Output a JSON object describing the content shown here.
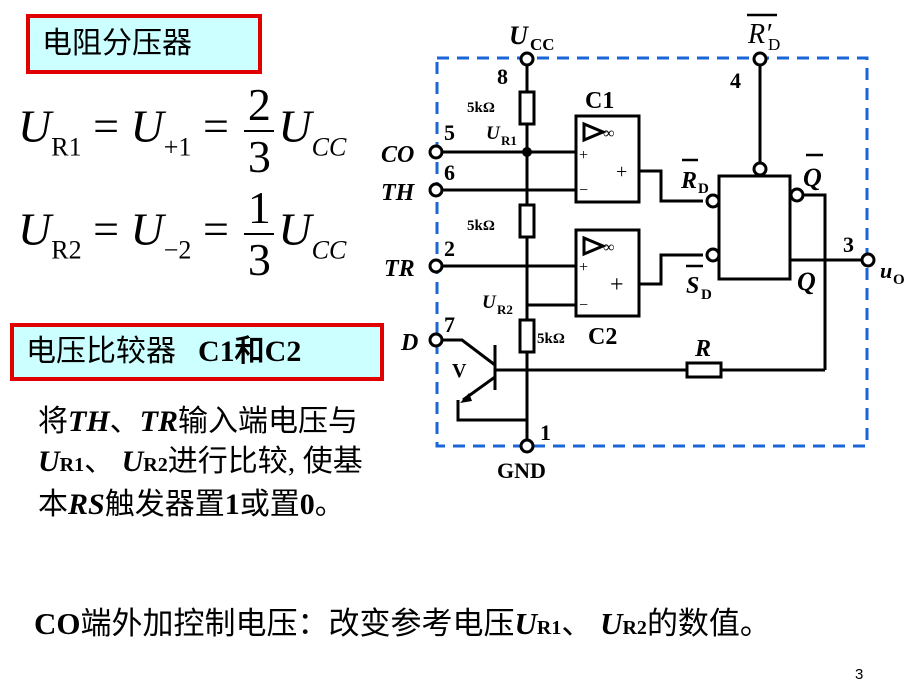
{
  "slide": {
    "page_number": "3",
    "section1": {
      "title": "电阻分压器"
    },
    "equations": {
      "eq1": {
        "lhs_main": "U",
        "lhs_sub": "R1",
        "mid_main": "U",
        "mid_sub": "+1",
        "num": "2",
        "den": "3",
        "rhs_main": "U",
        "rhs_sub": "CC"
      },
      "eq2": {
        "lhs_main": "U",
        "lhs_sub": "R2",
        "mid_main": "U",
        "mid_sub": "−2",
        "num": "1",
        "den": "3",
        "rhs_main": "U",
        "rhs_sub": "CC"
      }
    },
    "section2": {
      "title": "电压比较器",
      "title_latin": "C1和C2"
    },
    "paragraph": {
      "p1": "将",
      "th": "TH",
      "p2": "、",
      "tr": "TR",
      "p3": "输入端电压与",
      "u1": "U",
      "u1_sub": "R1",
      "p4": "、 ",
      "u2": "U",
      "u2_sub": "R2",
      "p5": "进行比较, 使基本",
      "rs": "RS",
      "p6": "触发器置",
      "one": "1",
      "p7": "或置",
      "zero": "0",
      "p8": "。"
    },
    "bottom": {
      "co": "CO",
      "t1": "端外加控制电压：改变参考电压",
      "u1": "U",
      "u1_sub": "R1",
      "t2": "、 ",
      "u2": "U",
      "u2_sub": "R2",
      "t3": "的数值。"
    }
  },
  "circuit": {
    "ucc_label": "U",
    "ucc_sub": "CC",
    "rd_prime_label": "R′",
    "rd_prime_sub": "D",
    "pins": {
      "p8": "8",
      "p4": "4",
      "p5": "5",
      "p6": "6",
      "p2": "2",
      "p7": "7",
      "p1": "1",
      "p3": "3"
    },
    "inputs": {
      "co": "CO",
      "th": "TH",
      "tr": "TR",
      "d": "D"
    },
    "resistor_label": "5kΩ",
    "ur1": "U",
    "ur1_sub": "R1",
    "ur2": "U",
    "ur2_sub": "R2",
    "c1": "C1",
    "c2": "C2",
    "inf": "∞",
    "plus": "+",
    "minus": "−",
    "rd_bar": "R",
    "rd_sub": "D",
    "sd_bar": "S",
    "sd_sub": "D",
    "qbar": "Q",
    "q": "Q",
    "uo": "u",
    "uo_sub": "O",
    "gnd": "GND",
    "transistor": "V",
    "r": "R",
    "colors": {
      "frame": "#1a66d9",
      "box_border": "#e00000",
      "box_fill": "#ccffff"
    }
  }
}
